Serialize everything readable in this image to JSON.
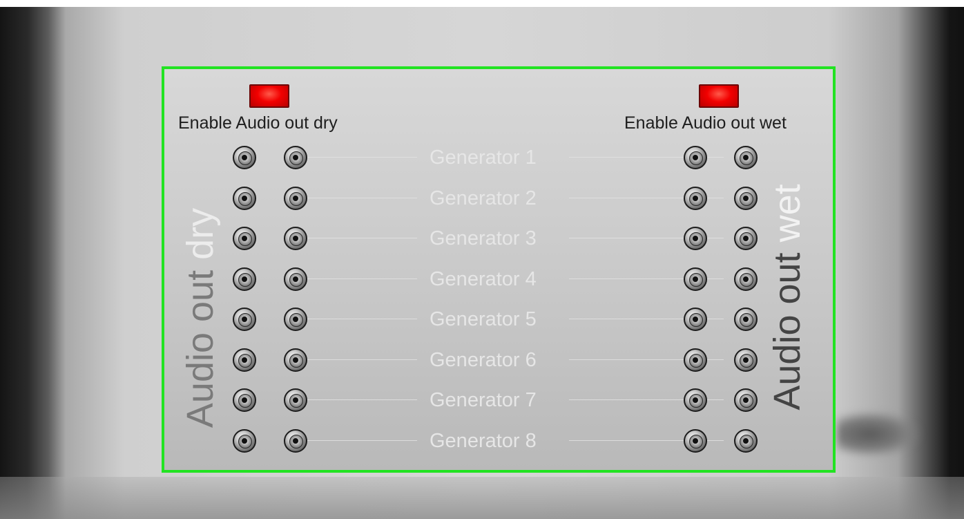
{
  "panel": {
    "dry": {
      "enable_label": "Enable Audio out dry",
      "vertical_prefix": "Audio out",
      "vertical_highlight": "dry"
    },
    "wet": {
      "enable_label": "Enable Audio out wet",
      "vertical_prefix": "Audio out",
      "vertical_highlight": "wet"
    },
    "generators": [
      {
        "label": "Generator 1"
      },
      {
        "label": "Generator 2"
      },
      {
        "label": "Generator 3"
      },
      {
        "label": "Generator 4"
      },
      {
        "label": "Generator 5"
      },
      {
        "label": "Generator 6"
      },
      {
        "label": "Generator 7"
      },
      {
        "label": "Generator 8"
      }
    ]
  },
  "colors": {
    "led_on": "#f20000",
    "highlight_border": "#22e322"
  }
}
